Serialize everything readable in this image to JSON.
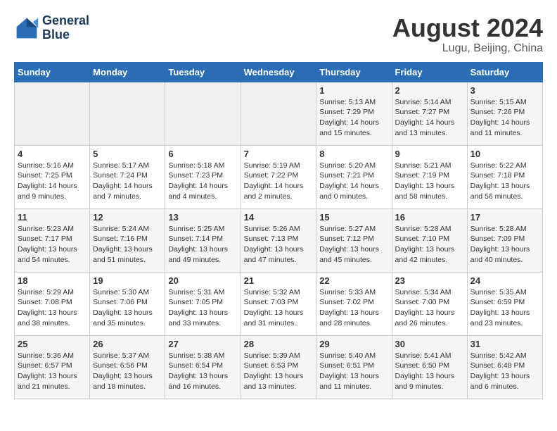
{
  "header": {
    "logo_line1": "General",
    "logo_line2": "Blue",
    "month_year": "August 2024",
    "location": "Lugu, Beijing, China"
  },
  "days_of_week": [
    "Sunday",
    "Monday",
    "Tuesday",
    "Wednesday",
    "Thursday",
    "Friday",
    "Saturday"
  ],
  "weeks": [
    [
      {
        "day": "",
        "info": ""
      },
      {
        "day": "",
        "info": ""
      },
      {
        "day": "",
        "info": ""
      },
      {
        "day": "",
        "info": ""
      },
      {
        "day": "1",
        "info": "Sunrise: 5:13 AM\nSunset: 7:29 PM\nDaylight: 14 hours and 15 minutes."
      },
      {
        "day": "2",
        "info": "Sunrise: 5:14 AM\nSunset: 7:27 PM\nDaylight: 14 hours and 13 minutes."
      },
      {
        "day": "3",
        "info": "Sunrise: 5:15 AM\nSunset: 7:26 PM\nDaylight: 14 hours and 11 minutes."
      }
    ],
    [
      {
        "day": "4",
        "info": "Sunrise: 5:16 AM\nSunset: 7:25 PM\nDaylight: 14 hours and 9 minutes."
      },
      {
        "day": "5",
        "info": "Sunrise: 5:17 AM\nSunset: 7:24 PM\nDaylight: 14 hours and 7 minutes."
      },
      {
        "day": "6",
        "info": "Sunrise: 5:18 AM\nSunset: 7:23 PM\nDaylight: 14 hours and 4 minutes."
      },
      {
        "day": "7",
        "info": "Sunrise: 5:19 AM\nSunset: 7:22 PM\nDaylight: 14 hours and 2 minutes."
      },
      {
        "day": "8",
        "info": "Sunrise: 5:20 AM\nSunset: 7:21 PM\nDaylight: 14 hours and 0 minutes."
      },
      {
        "day": "9",
        "info": "Sunrise: 5:21 AM\nSunset: 7:19 PM\nDaylight: 13 hours and 58 minutes."
      },
      {
        "day": "10",
        "info": "Sunrise: 5:22 AM\nSunset: 7:18 PM\nDaylight: 13 hours and 56 minutes."
      }
    ],
    [
      {
        "day": "11",
        "info": "Sunrise: 5:23 AM\nSunset: 7:17 PM\nDaylight: 13 hours and 54 minutes."
      },
      {
        "day": "12",
        "info": "Sunrise: 5:24 AM\nSunset: 7:16 PM\nDaylight: 13 hours and 51 minutes."
      },
      {
        "day": "13",
        "info": "Sunrise: 5:25 AM\nSunset: 7:14 PM\nDaylight: 13 hours and 49 minutes."
      },
      {
        "day": "14",
        "info": "Sunrise: 5:26 AM\nSunset: 7:13 PM\nDaylight: 13 hours and 47 minutes."
      },
      {
        "day": "15",
        "info": "Sunrise: 5:27 AM\nSunset: 7:12 PM\nDaylight: 13 hours and 45 minutes."
      },
      {
        "day": "16",
        "info": "Sunrise: 5:28 AM\nSunset: 7:10 PM\nDaylight: 13 hours and 42 minutes."
      },
      {
        "day": "17",
        "info": "Sunrise: 5:28 AM\nSunset: 7:09 PM\nDaylight: 13 hours and 40 minutes."
      }
    ],
    [
      {
        "day": "18",
        "info": "Sunrise: 5:29 AM\nSunset: 7:08 PM\nDaylight: 13 hours and 38 minutes."
      },
      {
        "day": "19",
        "info": "Sunrise: 5:30 AM\nSunset: 7:06 PM\nDaylight: 13 hours and 35 minutes."
      },
      {
        "day": "20",
        "info": "Sunrise: 5:31 AM\nSunset: 7:05 PM\nDaylight: 13 hours and 33 minutes."
      },
      {
        "day": "21",
        "info": "Sunrise: 5:32 AM\nSunset: 7:03 PM\nDaylight: 13 hours and 31 minutes."
      },
      {
        "day": "22",
        "info": "Sunrise: 5:33 AM\nSunset: 7:02 PM\nDaylight: 13 hours and 28 minutes."
      },
      {
        "day": "23",
        "info": "Sunrise: 5:34 AM\nSunset: 7:00 PM\nDaylight: 13 hours and 26 minutes."
      },
      {
        "day": "24",
        "info": "Sunrise: 5:35 AM\nSunset: 6:59 PM\nDaylight: 13 hours and 23 minutes."
      }
    ],
    [
      {
        "day": "25",
        "info": "Sunrise: 5:36 AM\nSunset: 6:57 PM\nDaylight: 13 hours and 21 minutes."
      },
      {
        "day": "26",
        "info": "Sunrise: 5:37 AM\nSunset: 6:56 PM\nDaylight: 13 hours and 18 minutes."
      },
      {
        "day": "27",
        "info": "Sunrise: 5:38 AM\nSunset: 6:54 PM\nDaylight: 13 hours and 16 minutes."
      },
      {
        "day": "28",
        "info": "Sunrise: 5:39 AM\nSunset: 6:53 PM\nDaylight: 13 hours and 13 minutes."
      },
      {
        "day": "29",
        "info": "Sunrise: 5:40 AM\nSunset: 6:51 PM\nDaylight: 13 hours and 11 minutes."
      },
      {
        "day": "30",
        "info": "Sunrise: 5:41 AM\nSunset: 6:50 PM\nDaylight: 13 hours and 9 minutes."
      },
      {
        "day": "31",
        "info": "Sunrise: 5:42 AM\nSunset: 6:48 PM\nDaylight: 13 hours and 6 minutes."
      }
    ]
  ]
}
